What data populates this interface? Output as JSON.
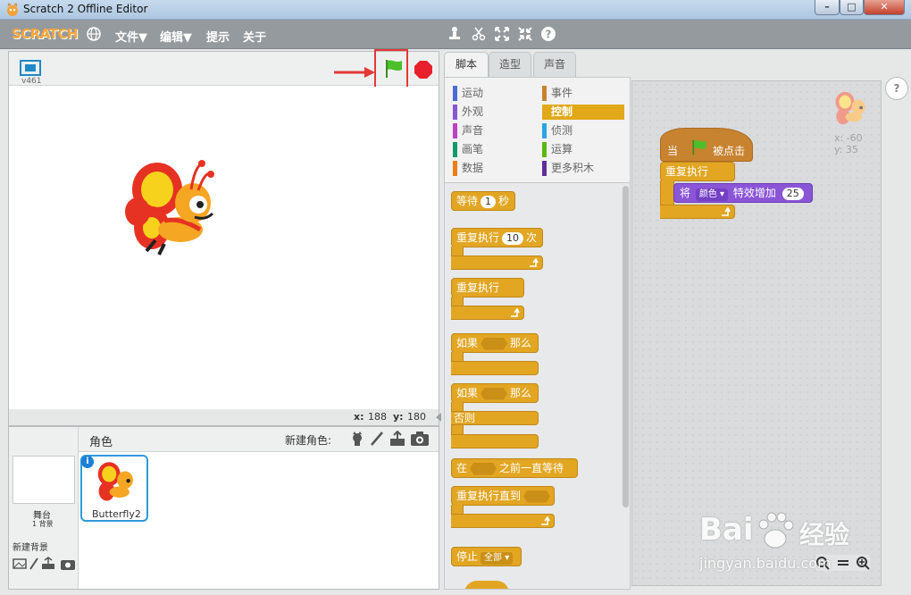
{
  "window": {
    "title": "Scratch 2 Offline Editor",
    "min": "–",
    "max": "□",
    "close": "✕"
  },
  "menubar": {
    "logo": "SCRATCH",
    "items": [
      "文件▼",
      "编辑▼",
      "提示",
      "关于"
    ]
  },
  "stage": {
    "version": "v461",
    "coords": {
      "x_label": "x:",
      "x": "188",
      "y_label": "y:",
      "y": "180"
    }
  },
  "sprites": {
    "header": "角色",
    "new_sprite_label": "新建角色:",
    "stage_label": "舞台",
    "backdrop_count": "1 背景",
    "new_backdrop_label": "新建背景",
    "sprite_name": "Butterfly2",
    "info": "i"
  },
  "tabs": [
    "脚本",
    "造型",
    "声音"
  ],
  "categories": [
    {
      "label": "运动",
      "color": "#4a6cd4"
    },
    {
      "label": "事件",
      "color": "#c88330"
    },
    {
      "label": "外观",
      "color": "#8a55d7"
    },
    {
      "label": "控制",
      "color": "#e1a91a"
    },
    {
      "label": "声音",
      "color": "#bb42c3"
    },
    {
      "label": "侦测",
      "color": "#2ca5e2"
    },
    {
      "label": "画笔",
      "color": "#0e9a6c"
    },
    {
      "label": "运算",
      "color": "#5cb712"
    },
    {
      "label": "数据",
      "color": "#ee7d16"
    },
    {
      "label": "更多积木",
      "color": "#632d99"
    }
  ],
  "palette": {
    "wait": {
      "pre": "等待",
      "val": "1",
      "post": "秒"
    },
    "repeat": {
      "pre": "重复执行",
      "val": "10",
      "post": "次"
    },
    "forever": "重复执行",
    "if_then": {
      "pre": "如果",
      "post": "那么"
    },
    "if_else": {
      "pre": "如果",
      "post": "那么",
      "else": "否则"
    },
    "wait_until": {
      "pre": "在",
      "post": "之前一直等待"
    },
    "repeat_until": "重复执行直到",
    "stop": {
      "pre": "停止",
      "val": "全部"
    }
  },
  "script": {
    "hat": {
      "pre": "当",
      "post": "被点击"
    },
    "forever": "重复执行",
    "effect": {
      "pre": "将",
      "effect": "颜色",
      "mid": "特效增加",
      "val": "25"
    },
    "sprite_x": "x: -60",
    "sprite_y": "y: 35"
  },
  "help": "?",
  "watermark": {
    "brand": "Bai",
    "brand2": "经验",
    "url": "jingyan.baidu.com"
  }
}
